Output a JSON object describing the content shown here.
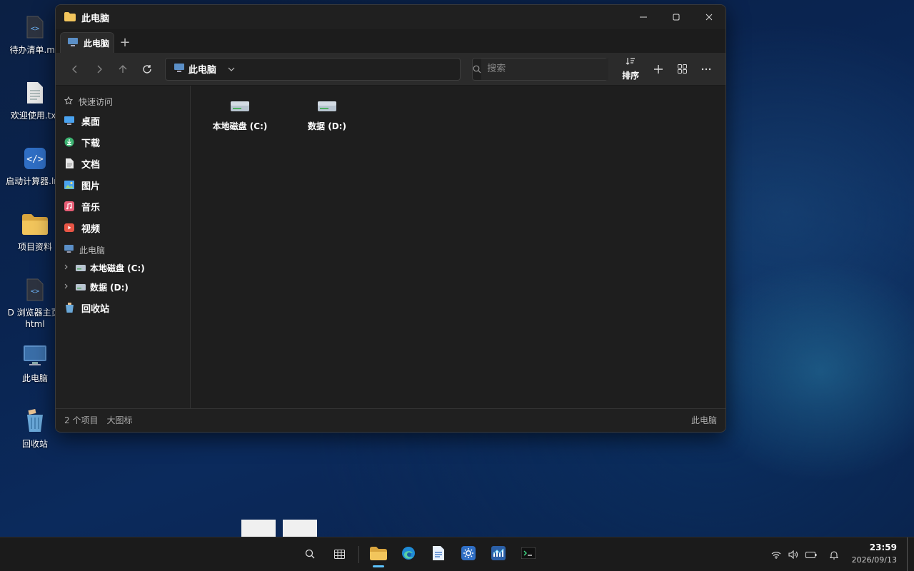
{
  "desktop": {
    "icons": [
      {
        "label": "待办清单.md",
        "icon": "code-file-icon"
      },
      {
        "label": "欢迎使用.txt",
        "icon": "text-file-icon"
      },
      {
        "label": "启动计算器.lnk",
        "icon": "code-shortcut-icon"
      },
      {
        "label": "项目资料",
        "icon": "folder-icon"
      },
      {
        "label": "D 浏览器主页.html",
        "icon": "code-file-icon"
      },
      {
        "label": "此电脑",
        "icon": "monitor-icon"
      },
      {
        "label": "回收站",
        "icon": "recycle-bin-icon"
      }
    ]
  },
  "window": {
    "title": "此电脑",
    "tab_label": "此电脑",
    "address": "此电脑",
    "search_placeholder": "搜索",
    "sort_label": "排序",
    "sidebar": {
      "quick_access_label": "快速访问",
      "items": [
        {
          "label": "桌面",
          "icon": "desktop-icon",
          "color": "#4aa3f0"
        },
        {
          "label": "下载",
          "icon": "download-icon",
          "color": "#3cb371"
        },
        {
          "label": "文档",
          "icon": "document-icon",
          "color": "#e8e8e8"
        },
        {
          "label": "图片",
          "icon": "picture-icon",
          "color": "#4aa3f0"
        },
        {
          "label": "音乐",
          "icon": "music-icon",
          "color": "#e85d75"
        },
        {
          "label": "视频",
          "icon": "video-icon",
          "color": "#e85545"
        }
      ],
      "this_pc_label": "此电脑",
      "drives": [
        {
          "label": "本地磁盘 (C:)"
        },
        {
          "label": "数据 (D:)"
        }
      ],
      "recycle_label": "回收站"
    },
    "main": {
      "drives": [
        {
          "label": "本地磁盘 (C:)"
        },
        {
          "label": "数据 (D:)"
        }
      ]
    },
    "status": {
      "count": "2 个项目",
      "view": "大图标",
      "location": "此电脑"
    }
  },
  "taskbar": {
    "time": "23:59",
    "date": "2026/09/13"
  }
}
